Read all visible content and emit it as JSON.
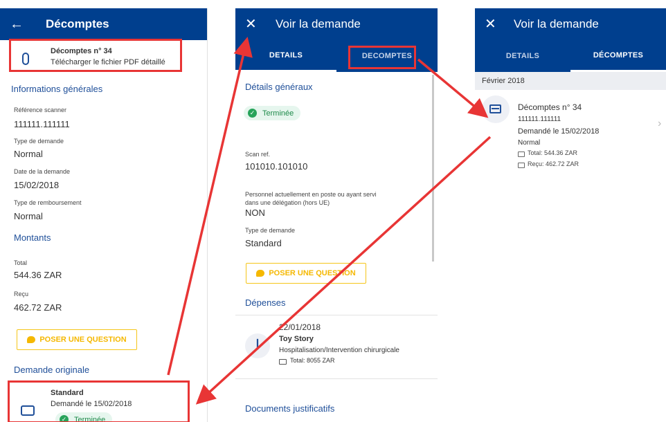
{
  "left": {
    "title": "Décomptes",
    "file": {
      "title": "Décomptes n° 34",
      "action": "Télécharger le fichier PDF détaillé"
    },
    "general_title": "Informations générales",
    "fields": [
      {
        "label": "Référence scanner",
        "value": "111111.111111"
      },
      {
        "label": "Type de demande",
        "value": "Normal"
      },
      {
        "label": "Date de la demande",
        "value": "15/02/2018"
      },
      {
        "label": "Type de remboursement",
        "value": "Normal"
      }
    ],
    "amounts_title": "Montants",
    "amounts": [
      {
        "label": "Total",
        "value": "544.36 ZAR"
      },
      {
        "label": "Reçu",
        "value": "462.72 ZAR"
      }
    ],
    "question_button": "POSER UNE QUESTION",
    "original_title": "Demande originale",
    "original": {
      "type": "Standard",
      "date": "Demandé le 15/02/2018",
      "status": "Terminée"
    }
  },
  "middle": {
    "title": "Voir la demande",
    "tabs": [
      "DETAILS",
      "DECOMPTES"
    ],
    "general_title": "Détails généraux",
    "status": "Terminée",
    "scan_label": "Scan ref.",
    "scan_value": "101010.101010",
    "personnel_label": "Personnel actuellement en poste ou ayant servi dans une délégation (hors UE)",
    "personnel_value": "NON",
    "type_label": "Type de demande",
    "type_value": "Standard",
    "question_button": "POSER UNE QUESTION",
    "expenses_title": "Dépenses",
    "expense": {
      "date": "22/01/2018",
      "name": "Toy Story",
      "category": "Hospitalisation/Intervention chirurgicale",
      "total": "Total: 8055 ZAR"
    },
    "documents_title": "Documents justificatifs"
  },
  "right": {
    "title": "Voir la demande",
    "tabs": [
      "DETAILS",
      "DÉCOMPTES"
    ],
    "month": "Février 2018",
    "card": {
      "title": "Décomptes n° 34",
      "ref": "111111.111111",
      "date": "Demandé le 15/02/2018",
      "type": "Normal",
      "total": "Total: 544.36 ZAR",
      "received": "Reçu: 462.72 ZAR"
    }
  }
}
